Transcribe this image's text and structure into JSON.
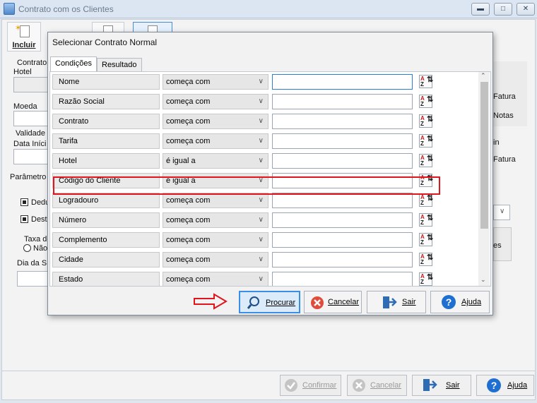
{
  "window": {
    "title": "Contrato com os Clientes",
    "toolbar": {
      "incluir_label": "Incluir"
    }
  },
  "background": {
    "contrato_label": "Contrato",
    "hotel_label": "Hotel",
    "moeda_label": "Moeda",
    "validade_label": "Validade",
    "data_inicio_label": "Data Iníci",
    "parametro_label": "Parâmetro",
    "dedu_label": "Dedu",
    "dest_label": "Dest",
    "taxa_label": "Taxa de",
    "nao_label": "Não",
    "dia_label": "Dia da S",
    "fatura1_label": "Fatura",
    "notas_label": "Notas",
    "in_label": "in",
    "fatura2_label": "Fatura",
    "es_label": "es"
  },
  "dialog": {
    "title": "Selecionar Contrato Normal",
    "tabs": [
      {
        "label": "Condições",
        "active": true
      },
      {
        "label": "Resultado",
        "active": false
      }
    ],
    "rows": [
      {
        "field": "Nome",
        "operator": "começa com",
        "value": ""
      },
      {
        "field": "Razão Social",
        "operator": "começa com",
        "value": ""
      },
      {
        "field": "Contrato",
        "operator": "começa com",
        "value": ""
      },
      {
        "field": "Tarifa",
        "operator": "começa com",
        "value": ""
      },
      {
        "field": "Hotel",
        "operator": "é igual a",
        "value": ""
      },
      {
        "field": "Código do Cliente",
        "operator": "é igual a",
        "value": ""
      },
      {
        "field": "Logradouro",
        "operator": "começa com",
        "value": ""
      },
      {
        "field": "Número",
        "operator": "começa com",
        "value": ""
      },
      {
        "field": "Complemento",
        "operator": "começa com",
        "value": ""
      },
      {
        "field": "Cidade",
        "operator": "começa com",
        "value": ""
      },
      {
        "field": "Estado",
        "operator": "começa com",
        "value": ""
      }
    ],
    "buttons": {
      "procurar": "Procurar",
      "cancelar": "Cancelar",
      "sair": "Sair",
      "ajuda": "Ajuda"
    }
  },
  "bottom": {
    "confirmar": "Confirmar",
    "cancelar": "Cancelar",
    "sair": "Sair",
    "ajuda": "Ajuda"
  },
  "colors": {
    "highlight": "#e0161c",
    "accent": "#2b7fd4",
    "cancel": "#e14b3b",
    "help": "#1f6fd1"
  }
}
